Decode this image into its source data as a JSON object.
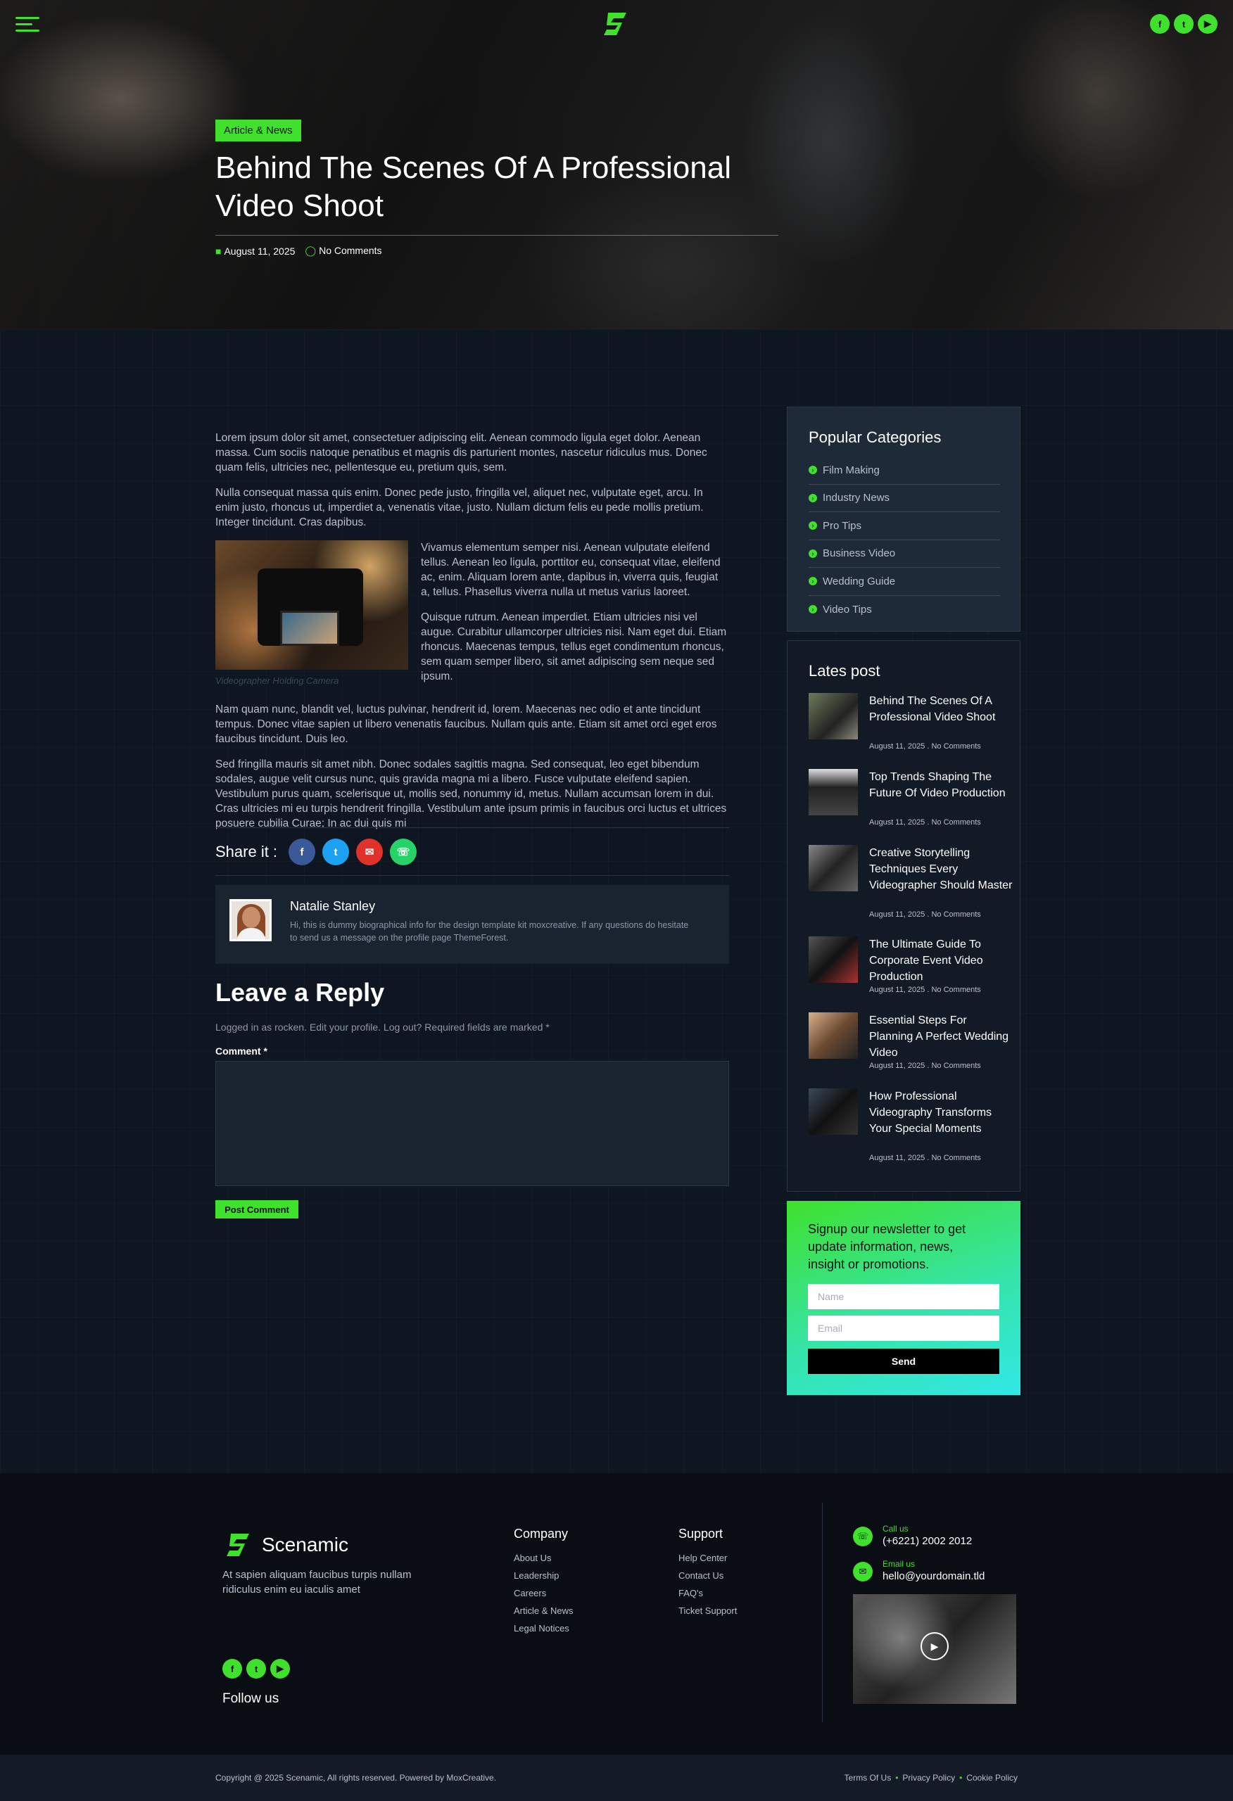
{
  "hero": {
    "badge": "Article & News",
    "title": "Behind The Scenes Of A Professional Video Shoot",
    "date": "August 11, 2025",
    "comments": "No Comments"
  },
  "article": {
    "p1": "Lorem ipsum dolor sit amet, consectetuer adipiscing elit. Aenean commodo ligula eget dolor. Aenean massa. Cum sociis natoque penatibus et magnis dis parturient montes, nascetur ridiculus mus. Donec quam felis, ultricies nec, pellentesque eu, pretium quis, sem.",
    "p2": "Nulla consequat massa quis enim. Donec pede justo, fringilla vel, aliquet nec, vulputate eget, arcu. In enim justo, rhoncus ut, imperdiet a, venenatis vitae, justo. Nullam dictum felis eu pede mollis pretium. Integer tincidunt. Cras dapibus.",
    "p3": "Vivamus elementum semper nisi. Aenean vulputate eleifend tellus. Aenean leo ligula, porttitor eu, consequat vitae, eleifend ac, enim. Aliquam lorem ante, dapibus in, viverra quis, feugiat a, tellus. Phasellus viverra nulla ut metus varius laoreet.",
    "p4": "Quisque rutrum. Aenean imperdiet. Etiam ultricies nisi vel augue. Curabitur ullamcorper ultricies nisi. Nam eget dui. Etiam rhoncus. Maecenas tempus, tellus eget condimentum rhoncus, sem quam semper libero, sit amet adipiscing sem neque sed ipsum.",
    "caption": "Videographer Holding Camera",
    "p5": "Nam quam nunc, blandit vel, luctus pulvinar, hendrerit id, lorem. Maecenas nec odio et ante tincidunt tempus. Donec vitae sapien ut libero venenatis faucibus. Nullam quis ante. Etiam sit amet orci eget eros faucibus tincidunt. Duis leo.",
    "p6": "Sed fringilla mauris sit amet nibh. Donec sodales sagittis magna. Sed consequat, leo eget bibendum sodales, augue velit cursus nunc, quis gravida magna mi a libero. Fusce vulputate eleifend sapien. Vestibulum purus quam, scelerisque ut, mollis sed, nonummy id, metus. Nullam accumsan lorem in dui. Cras ultricies mi eu turpis hendrerit fringilla. Vestibulum ante ipsum primis in faucibus orci luctus et ultrices posuere cubilia Curae; In ac dui quis mi"
  },
  "share": {
    "label": "Share it :"
  },
  "author": {
    "name": "Natalie Stanley",
    "bio": "Hi, this is dummy biographical info for the design template kit moxcreative. If any questions do hesitate to send us a message on the profile page ThemeForest."
  },
  "reply": {
    "heading": "Leave a Reply",
    "logged": "Logged in as rocken. Edit your profile. Log out? Required fields are marked *",
    "comment_label": "Comment *",
    "submit": "Post Comment"
  },
  "sidebar": {
    "categories_title": "Popular Categories",
    "categories": [
      "Film Making",
      "Industry News",
      "Pro Tips",
      "Business Video",
      "Wedding Guide",
      "Video Tips"
    ],
    "latest_title": "Lates post",
    "posts": [
      {
        "title": "Behind The Scenes Of A Professional Video Shoot",
        "meta": "August 11, 2025 . No Comments"
      },
      {
        "title": "Top Trends Shaping The Future Of Video Production",
        "meta": "August 11, 2025 . No Comments"
      },
      {
        "title": "Creative Storytelling Techniques Every Videographer Should Master",
        "meta": "August 11, 2025 . No Comments"
      },
      {
        "title": "The Ultimate Guide To Corporate Event Video Production",
        "meta": "August 11, 2025 . No Comments"
      },
      {
        "title": "Essential Steps For Planning A Perfect Wedding Video",
        "meta": "August 11, 2025 . No Comments"
      },
      {
        "title": "How Professional Videography Transforms Your Special Moments",
        "meta": "August 11, 2025 . No Comments"
      }
    ],
    "newsletter": {
      "text": "Signup our newsletter to get update information, news, insight or promotions.",
      "name_placeholder": "Name",
      "email_placeholder": "Email",
      "send": "Send"
    }
  },
  "footer": {
    "brand": "Scenamic",
    "desc": "At sapien aliquam faucibus turpis nullam ridiculus enim eu iaculis amet",
    "follow": "Follow us",
    "company_title": "Company",
    "company_links": [
      "About Us",
      "Leadership",
      "Careers",
      "Article & News",
      "Legal Notices"
    ],
    "support_title": "Support",
    "support_links": [
      "Help Center",
      "Contact Us",
      "FAQ's",
      "Ticket Support"
    ],
    "call_label": "Call us",
    "call_value": "(+6221) 2002 2012",
    "email_label": "Email us",
    "email_value": "hello@yourdomain.tld",
    "copyright": "Copyright @ 2025 Scenamic, All rights reserved. Powered by MoxCreative.",
    "legal": [
      "Terms Of Us",
      "Privacy Policy",
      "Cookie Policy"
    ]
  },
  "icons": {
    "accent": "#3fe12c",
    "facebook": "#3b5998",
    "twitter": "#1da1f2",
    "email": "#e0322b",
    "whatsapp": "#25d366"
  }
}
